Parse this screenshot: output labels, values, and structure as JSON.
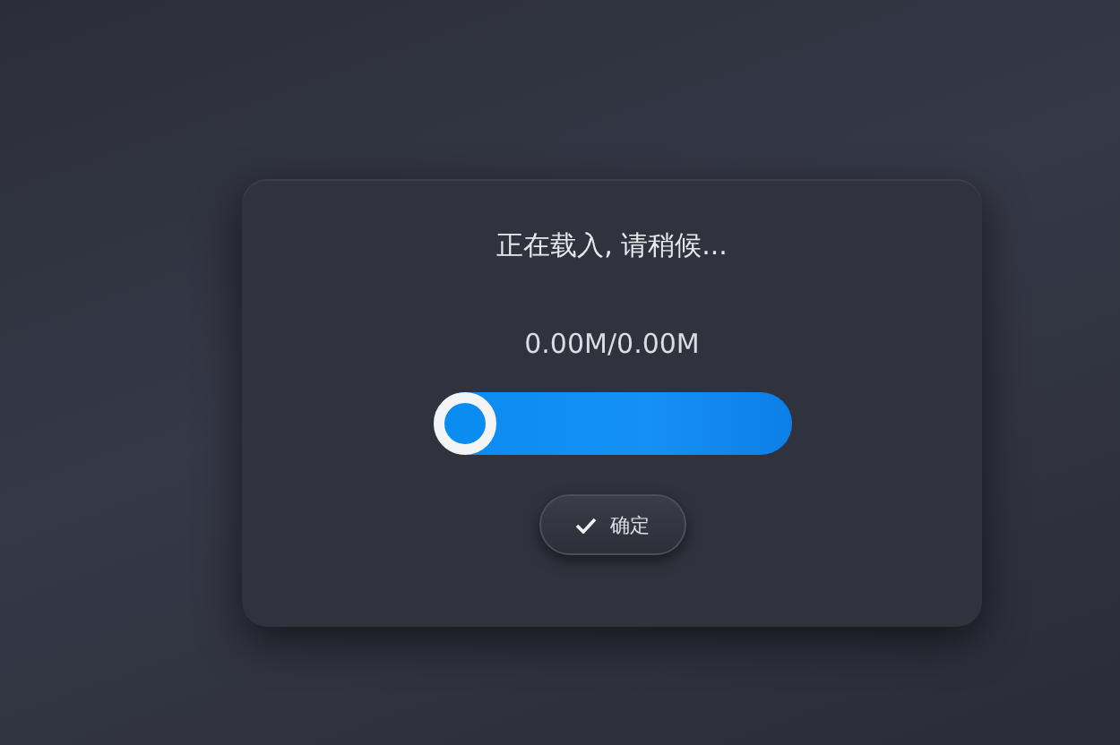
{
  "dialog": {
    "title": "正在载入, 请稍候...",
    "reading": "0.00M/0.00M",
    "progress": {
      "level": 0
    },
    "button": {
      "label": "确定"
    }
  }
}
